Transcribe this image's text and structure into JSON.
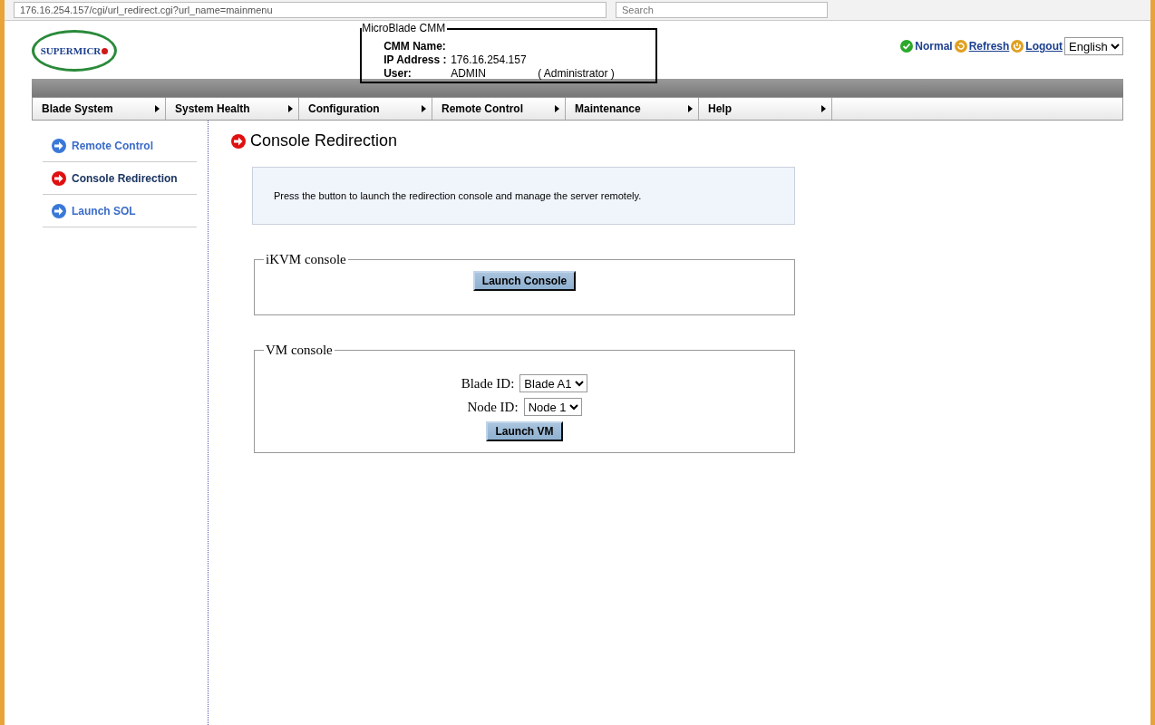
{
  "browser": {
    "url": "176.16.254.157/cgi/url_redirect.cgi?url_name=mainmenu",
    "search_placeholder": "Search"
  },
  "header": {
    "logo": "SUPERMICR",
    "info_box": {
      "title": "MicroBlade CMM",
      "rows": [
        {
          "label": "CMM Name:",
          "value": ""
        },
        {
          "label": "IP Address :",
          "value": "176.16.254.157"
        },
        {
          "label": "User:",
          "value": "ADMIN",
          "extra": "( Administrator )"
        }
      ]
    },
    "status": "Normal",
    "links": [
      {
        "kind": "refresh",
        "label": "Refresh"
      },
      {
        "kind": "logout",
        "label": "Logout"
      }
    ],
    "language": "English"
  },
  "menu": [
    "Blade System",
    "System Health",
    "Configuration",
    "Remote Control",
    "Maintenance",
    "Help"
  ],
  "sidebar": {
    "items": [
      {
        "label": "Remote Control",
        "selected": false
      },
      {
        "label": "Console Redirection",
        "selected": true
      },
      {
        "label": "Launch SOL",
        "selected": false
      }
    ]
  },
  "main": {
    "title": "Console Redirection",
    "note": "Press the button to launch the redirection console and manage the server remotely.",
    "ikvm": {
      "legend": "iKVM console",
      "button": "Launch Console"
    },
    "vm": {
      "legend": "VM console",
      "fields": [
        {
          "label": "Blade ID:",
          "value": "Blade A1"
        },
        {
          "label": "Node ID:",
          "value": "Node 1"
        }
      ],
      "button": "Launch VM"
    }
  }
}
